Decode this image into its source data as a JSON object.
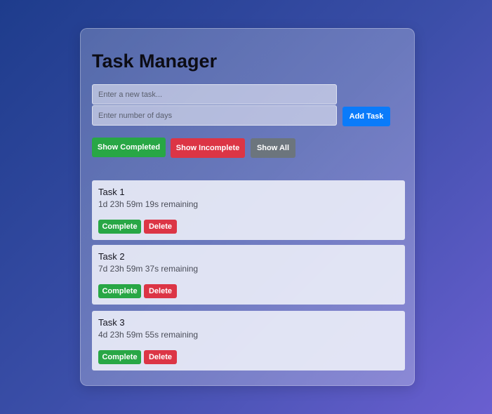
{
  "app": {
    "title": "Task Manager"
  },
  "form": {
    "task_placeholder": "Enter a new task...",
    "days_placeholder": "Enter number of days",
    "add_label": "Add Task"
  },
  "filters": {
    "show_completed": "Show Completed",
    "show_incomplete": "Show Incomplete",
    "show_all": "Show All"
  },
  "tasks": [
    {
      "name": "Task 1",
      "remaining": "1d 23h 59m 19s remaining",
      "complete_label": "Complete",
      "delete_label": "Delete"
    },
    {
      "name": "Task 2",
      "remaining": "7d 23h 59m 37s remaining",
      "complete_label": "Complete",
      "delete_label": "Delete"
    },
    {
      "name": "Task 3",
      "remaining": "4d 23h 59m 55s remaining",
      "complete_label": "Complete",
      "delete_label": "Delete"
    }
  ],
  "colors": {
    "primary": "#0a7bfa",
    "success": "#28a745",
    "danger": "#dc3545",
    "secondary": "#6c757d"
  }
}
